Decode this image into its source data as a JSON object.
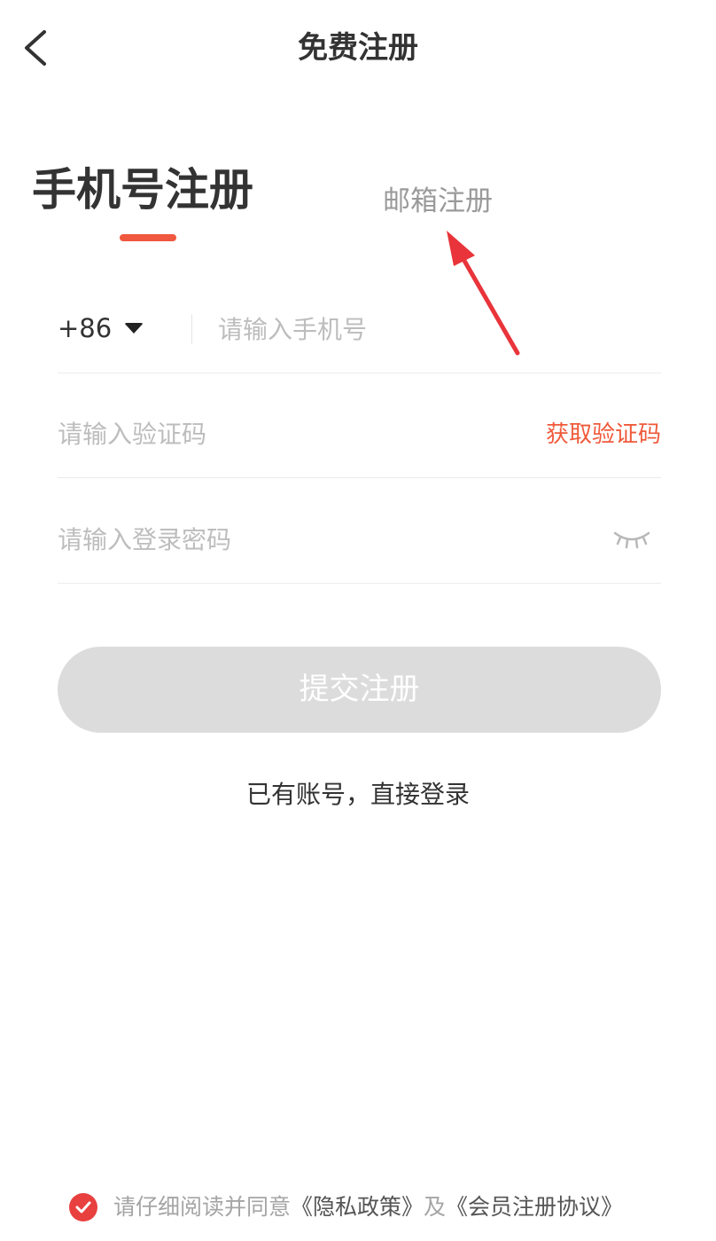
{
  "header": {
    "title": "免费注册"
  },
  "tabs": {
    "active_label": "手机号注册",
    "inactive_label": "邮箱注册"
  },
  "form": {
    "country_code": "+86",
    "phone_placeholder": "请输入手机号",
    "code_placeholder": "请输入验证码",
    "get_code_label": "获取验证码",
    "password_placeholder": "请输入登录密码"
  },
  "submit_label": "提交注册",
  "login_link_label": "已有账号，直接登录",
  "agreement": {
    "checked": true,
    "prefix": "请仔细阅读并同意",
    "privacy_link": "《隐私政策》",
    "connector": "及",
    "member_link": "《会员注册协议》"
  },
  "icons": {
    "back": "chevron-left-icon",
    "caret": "caret-down-icon",
    "eye": "eye-closed-icon",
    "check": "check-circle-icon"
  },
  "colors": {
    "accent": "#f0583f",
    "link_orange": "#ef5a3a",
    "disabled_button": "#dcdcdc",
    "check_red": "#e8403f"
  }
}
